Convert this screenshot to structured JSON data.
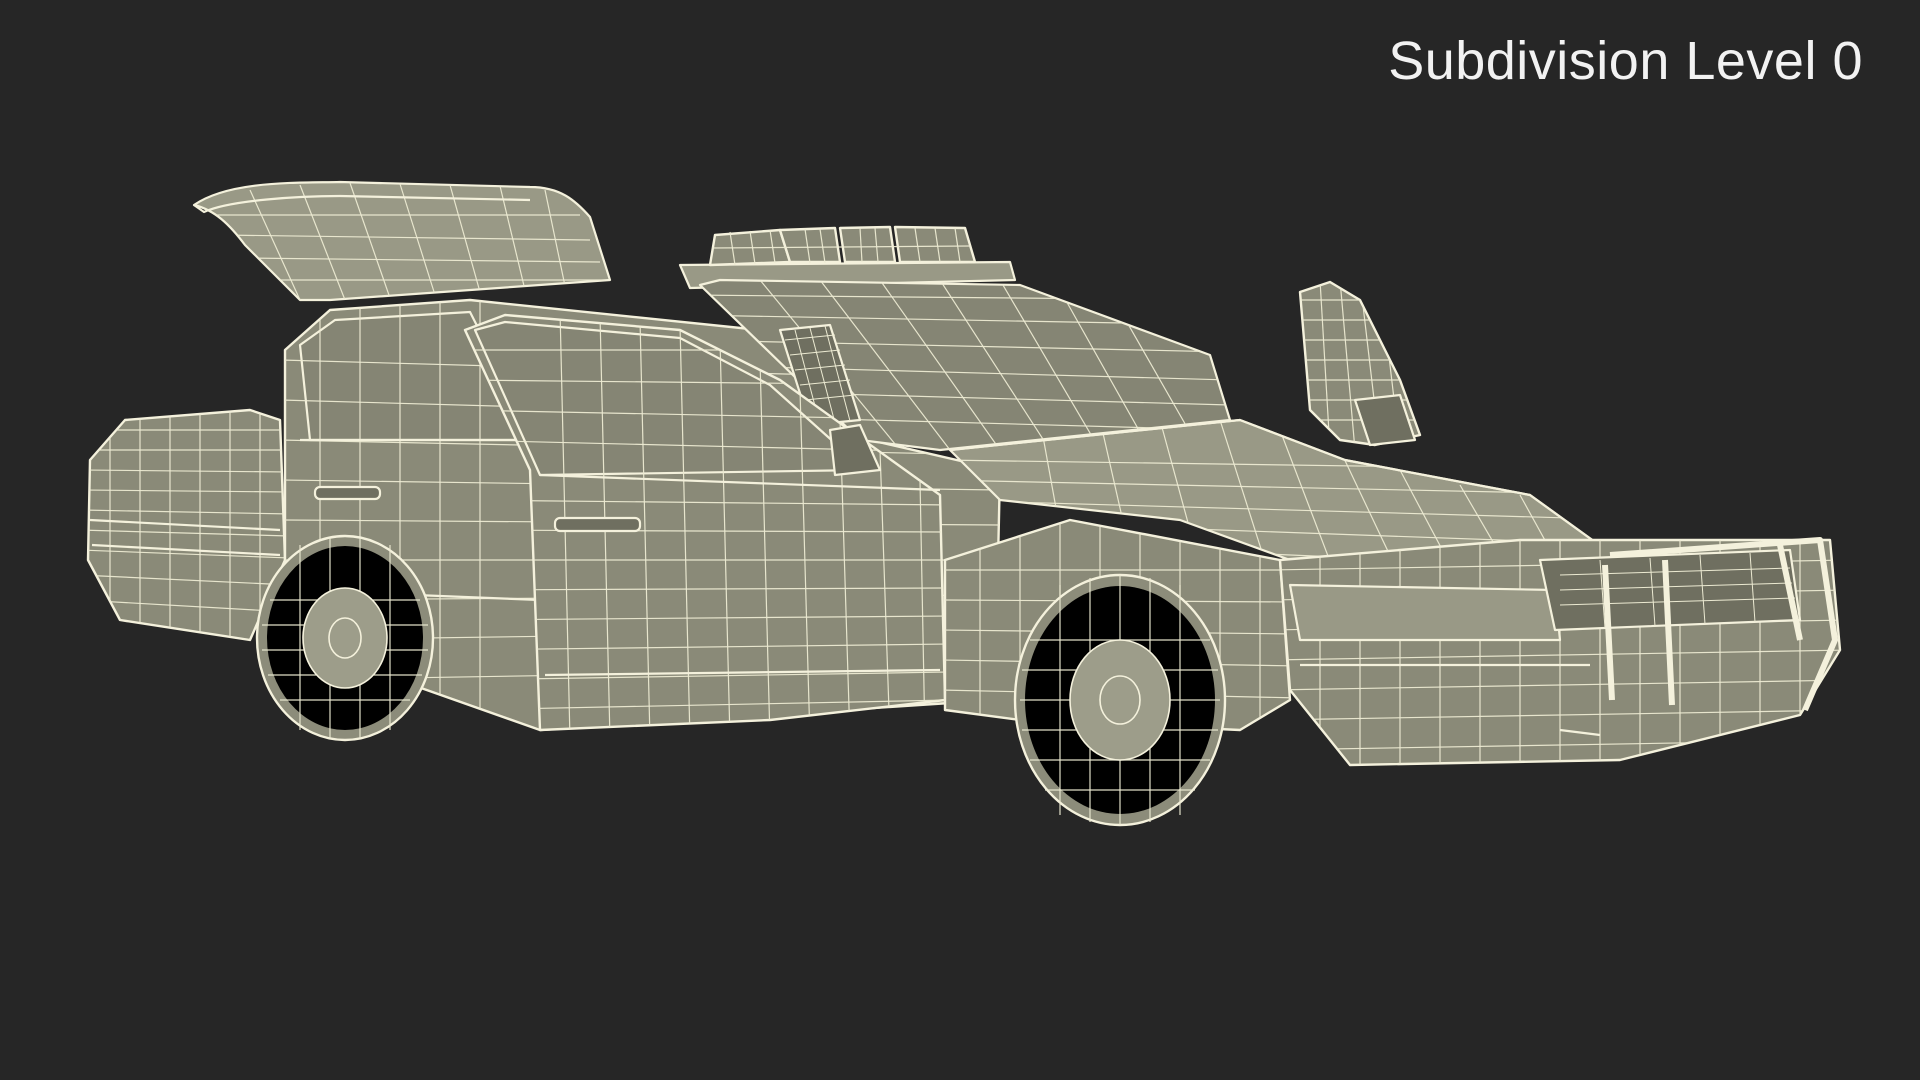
{
  "viewport": {
    "background_color": "#262626",
    "wire_color": "#f4f1dc",
    "surface_color": "#8a8a78"
  },
  "overlay": {
    "subdivision_label": "Subdivision Level 0"
  },
  "model": {
    "icon": "police-car-wireframe"
  }
}
